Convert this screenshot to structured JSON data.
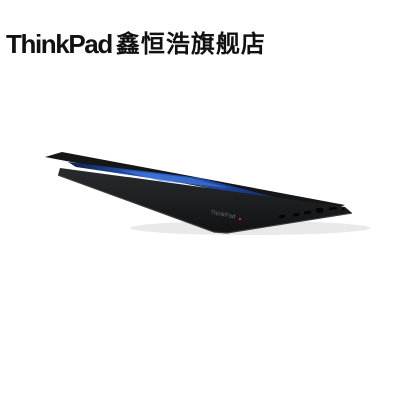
{
  "header": {
    "brand": "ThinkPad",
    "store": "鑫恒浩旗舰店"
  },
  "product": {
    "subject": "laptop-partially-open",
    "colors": {
      "body": "#1b1c1e",
      "screen": "#1a3f9c",
      "accent_red": "#d81e2a"
    }
  }
}
